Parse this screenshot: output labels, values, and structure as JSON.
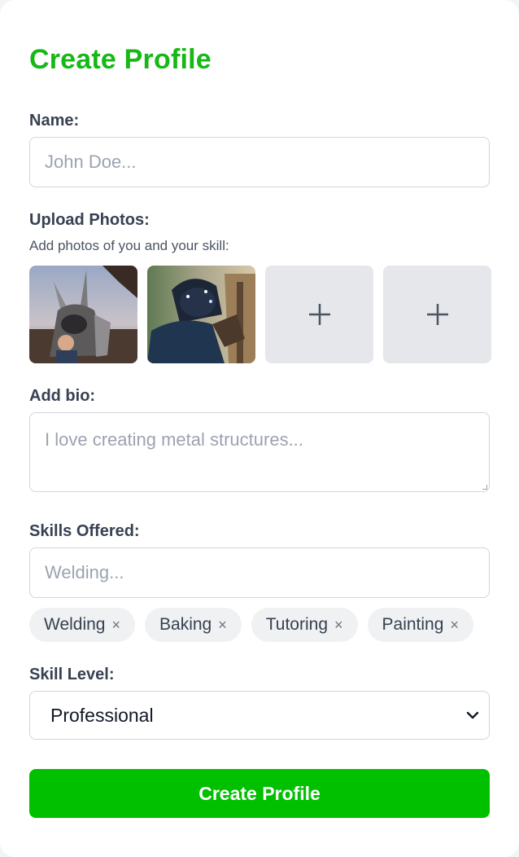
{
  "form": {
    "title": "Create Profile",
    "name": {
      "label": "Name:",
      "placeholder": "John Doe..."
    },
    "photos": {
      "label": "Upload Photos:",
      "hint": "Add photos of you and your skill:",
      "add_symbol": "+"
    },
    "bio": {
      "label": "Add bio:",
      "placeholder": "I love creating metal structures..."
    },
    "skills": {
      "label": "Skills Offered:",
      "placeholder": "Welding...",
      "tags": [
        {
          "label": "Welding",
          "remove": "×"
        },
        {
          "label": "Baking",
          "remove": "×"
        },
        {
          "label": "Tutoring",
          "remove": "×"
        },
        {
          "label": "Painting",
          "remove": "×"
        }
      ]
    },
    "level": {
      "label": "Skill Level:",
      "selected": "Professional"
    },
    "submit_label": "Create Profile"
  },
  "colors": {
    "accent": "#16b816",
    "button": "#00c000"
  }
}
